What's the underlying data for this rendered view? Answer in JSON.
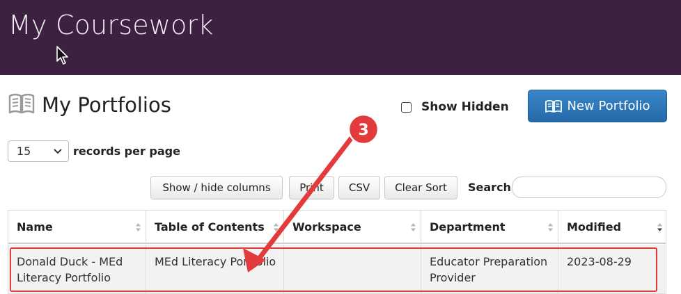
{
  "header": {
    "title": "My Coursework"
  },
  "page": {
    "title": "My Portfolios",
    "show_hidden_label": "Show Hidden",
    "new_portfolio_label": "New Portfolio"
  },
  "pagination": {
    "records_value": "15",
    "records_label": "records per page"
  },
  "toolbar": {
    "show_hide_columns": "Show / hide columns",
    "print": "Print",
    "csv": "CSV",
    "clear_sort": "Clear Sort",
    "search_label": "Search:",
    "search_value": ""
  },
  "table": {
    "columns": [
      "Name",
      "Table of Contents",
      "Workspace",
      "Department",
      "Modified"
    ],
    "rows": [
      {
        "name": "Donald Duck - MEd Literacy Portfolio",
        "toc": "MEd Literacy Portfolio",
        "workspace": "",
        "department": "Educator Preparation Provider",
        "modified": "2023-08-29"
      }
    ]
  },
  "annotation": {
    "step_number": "3",
    "color": "#e33b3b"
  },
  "colors": {
    "header_bg": "#3c2240",
    "primary_button": "#2a6fae",
    "row_bg": "#f2f2f2"
  },
  "icons": [
    "mouse-cursor-icon",
    "book-open-icon",
    "checkbox-icon",
    "chevron-down-icon",
    "sort-icon",
    "sort-desc-icon"
  ]
}
